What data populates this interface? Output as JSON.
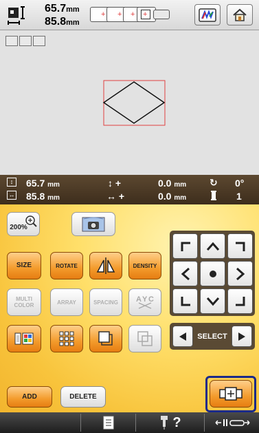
{
  "size": {
    "height_value": "65.7",
    "width_value": "85.8",
    "unit": "mm"
  },
  "info": {
    "height_value": "65.7",
    "width_value": "85.8",
    "unit": "mm",
    "move_v_sign": "+",
    "move_v_value": "0.0",
    "move_h_sign": "+",
    "move_h_value": "0.0",
    "rotation": "0°",
    "thread_count": "1"
  },
  "buttons": {
    "zoom_label": "200%",
    "size": "SIZE",
    "rotate": "ROTATE",
    "density": "DENSITY",
    "multicolor": "MULTI COLOR",
    "array": "ARRAY",
    "spacing": "SPACING",
    "select": "SELECT",
    "add": "ADD",
    "delete": "DELETE"
  },
  "colors": {
    "panel_accent": "#f8c43c",
    "info_bar": "#4a3824",
    "highlight": "#1a2a8a",
    "add_button": "#f39b2c"
  },
  "icons": [
    "size-icon",
    "hoop-icon",
    "thread-color-icon",
    "home-icon",
    "zoom-icon",
    "camera-icon",
    "mirror-icon",
    "spacing-icon",
    "thread-spool-icon",
    "array-icon",
    "border-icon",
    "group-icon",
    "arrow-icon",
    "center-icon",
    "checklist-icon",
    "help-icon",
    "needle-icon"
  ]
}
